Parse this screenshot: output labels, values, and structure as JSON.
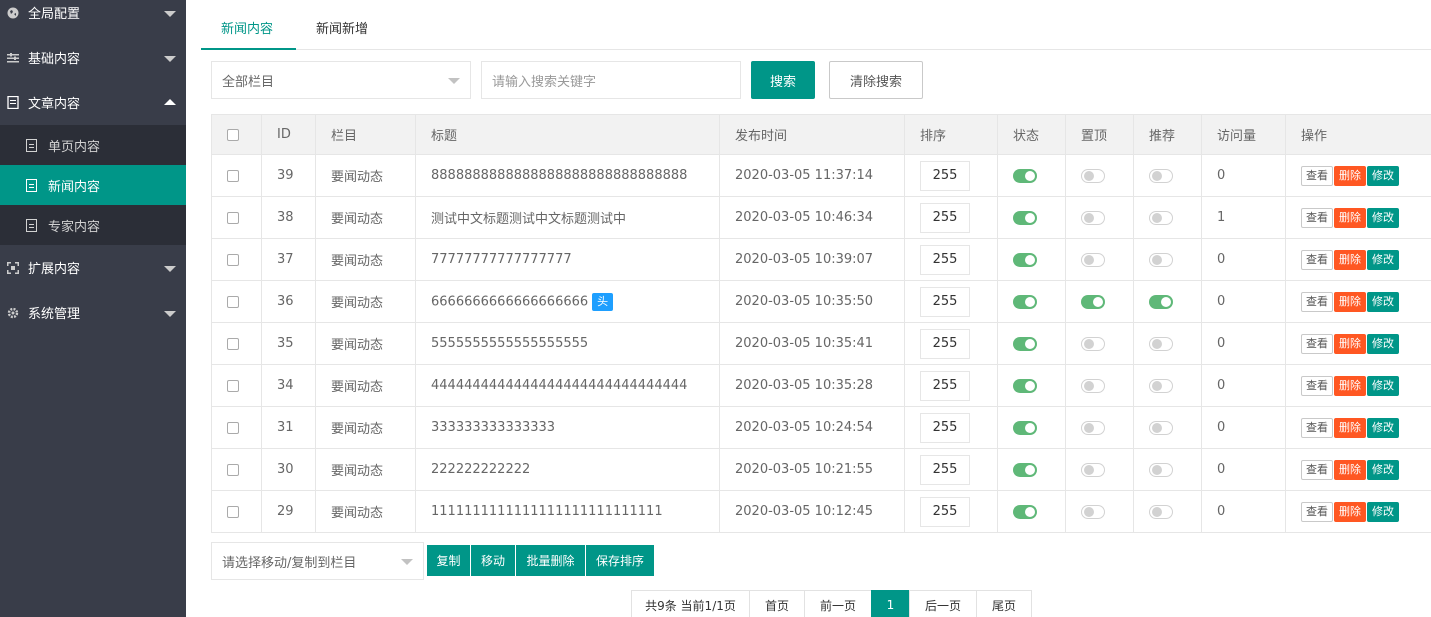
{
  "sidebar": {
    "items": [
      {
        "label": "全局配置",
        "icon": "globe-icon"
      },
      {
        "label": "基础内容",
        "icon": "sliders-icon"
      },
      {
        "label": "文章内容",
        "icon": "document-icon"
      },
      {
        "label": "扩展内容",
        "icon": "expand-icon"
      },
      {
        "label": "系统管理",
        "icon": "gear-icon"
      }
    ],
    "subitems": [
      {
        "label": "单页内容"
      },
      {
        "label": "新闻内容"
      },
      {
        "label": "专家内容"
      }
    ]
  },
  "tabs": [
    {
      "label": "新闻内容"
    },
    {
      "label": "新闻新增"
    }
  ],
  "search": {
    "category_select": "全部栏目",
    "keyword_placeholder": "请输入搜索关键字",
    "search_button": "搜索",
    "clear_button": "清除搜索"
  },
  "table": {
    "headers": [
      "ID",
      "栏目",
      "标题",
      "发布时间",
      "排序",
      "状态",
      "置顶",
      "推荐",
      "访问量",
      "操作"
    ],
    "rows": [
      {
        "id": "39",
        "category": "要闻动态",
        "title": "8888888888888888888888888888888",
        "time": "2020-03-05 11:37:14",
        "sort": "255",
        "status": true,
        "top": false,
        "recommend": false,
        "views": "0",
        "head": false
      },
      {
        "id": "38",
        "category": "要闻动态",
        "title": "测试中文标题测试中文标题测试中",
        "time": "2020-03-05 10:46:34",
        "sort": "255",
        "status": true,
        "top": false,
        "recommend": false,
        "views": "1",
        "head": false
      },
      {
        "id": "37",
        "category": "要闻动态",
        "title": "77777777777777777",
        "time": "2020-03-05 10:39:07",
        "sort": "255",
        "status": true,
        "top": false,
        "recommend": false,
        "views": "0",
        "head": false
      },
      {
        "id": "36",
        "category": "要闻动态",
        "title": "6666666666666666666",
        "time": "2020-03-05 10:35:50",
        "sort": "255",
        "status": true,
        "top": true,
        "recommend": true,
        "views": "0",
        "head": true
      },
      {
        "id": "35",
        "category": "要闻动态",
        "title": "5555555555555555555",
        "time": "2020-03-05 10:35:41",
        "sort": "255",
        "status": true,
        "top": false,
        "recommend": false,
        "views": "0",
        "head": false
      },
      {
        "id": "34",
        "category": "要闻动态",
        "title": "4444444444444444444444444444444",
        "time": "2020-03-05 10:35:28",
        "sort": "255",
        "status": true,
        "top": false,
        "recommend": false,
        "views": "0",
        "head": false
      },
      {
        "id": "31",
        "category": "要闻动态",
        "title": "333333333333333",
        "time": "2020-03-05 10:24:54",
        "sort": "255",
        "status": true,
        "top": false,
        "recommend": false,
        "views": "0",
        "head": false
      },
      {
        "id": "30",
        "category": "要闻动态",
        "title": "222222222222",
        "time": "2020-03-05 10:21:55",
        "sort": "255",
        "status": true,
        "top": false,
        "recommend": false,
        "views": "0",
        "head": false
      },
      {
        "id": "29",
        "category": "要闻动态",
        "title": "1111111111111111111111111111",
        "time": "2020-03-05 10:12:45",
        "sort": "255",
        "status": true,
        "top": false,
        "recommend": false,
        "views": "0",
        "head": false
      }
    ],
    "head_badge": "头",
    "actions": {
      "view": "查看",
      "delete": "删除",
      "edit": "修改"
    }
  },
  "bottom": {
    "move_select": "请选择移动/复制到栏目",
    "buttons": [
      "复制",
      "移动",
      "批量删除",
      "保存排序"
    ]
  },
  "pagination": {
    "summary": "共9条 当前1/1页",
    "first": "首页",
    "prev": "前一页",
    "current": "1",
    "next": "后一页",
    "last": "尾页"
  },
  "colors": {
    "accent": "#009688",
    "danger": "#ff5722",
    "sidebar_bg": "#393d49",
    "switch_on": "#5fb878",
    "badge": "#1e9fff"
  }
}
